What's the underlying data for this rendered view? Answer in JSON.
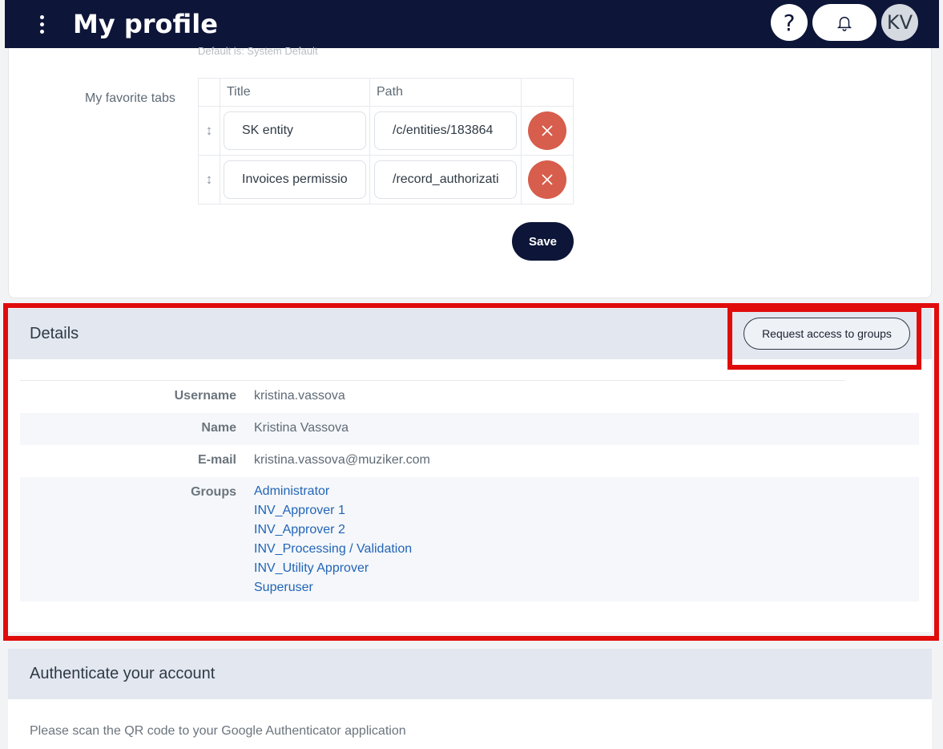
{
  "header": {
    "title": "My profile",
    "help_label": "?",
    "avatar_initials": "KV"
  },
  "preferences": {
    "hint": "Default is: System Default",
    "favorite_tabs_label": "My favorite tabs",
    "columns": {
      "title": "Title",
      "path": "Path"
    },
    "rows": [
      {
        "title": "SK entity",
        "path": "/c/entities/183864"
      },
      {
        "title": "Invoices permissions",
        "path": "/record_authorizations"
      }
    ],
    "save_label": "Save"
  },
  "details": {
    "title": "Details",
    "request_button": "Request access to groups",
    "fields": {
      "username_label": "Username",
      "username": "kristina.vassova",
      "name_label": "Name",
      "name": "Kristina Vassova",
      "email_label": "E-mail",
      "email": "kristina.vassova@muziker.com",
      "groups_label": "Groups"
    },
    "groups": [
      "Administrator",
      "INV_Approver 1",
      "INV_Approver 2",
      "INV_Processing / Validation",
      "INV_Utility Approver",
      "Superuser"
    ]
  },
  "auth": {
    "title": "Authenticate your account",
    "text": "Please scan the QR code to your Google Authenticator application"
  },
  "colors": {
    "navbar": "#0d1538",
    "delete": "#d75d4c",
    "highlight": "#e00c0c",
    "link": "#2265b7"
  }
}
